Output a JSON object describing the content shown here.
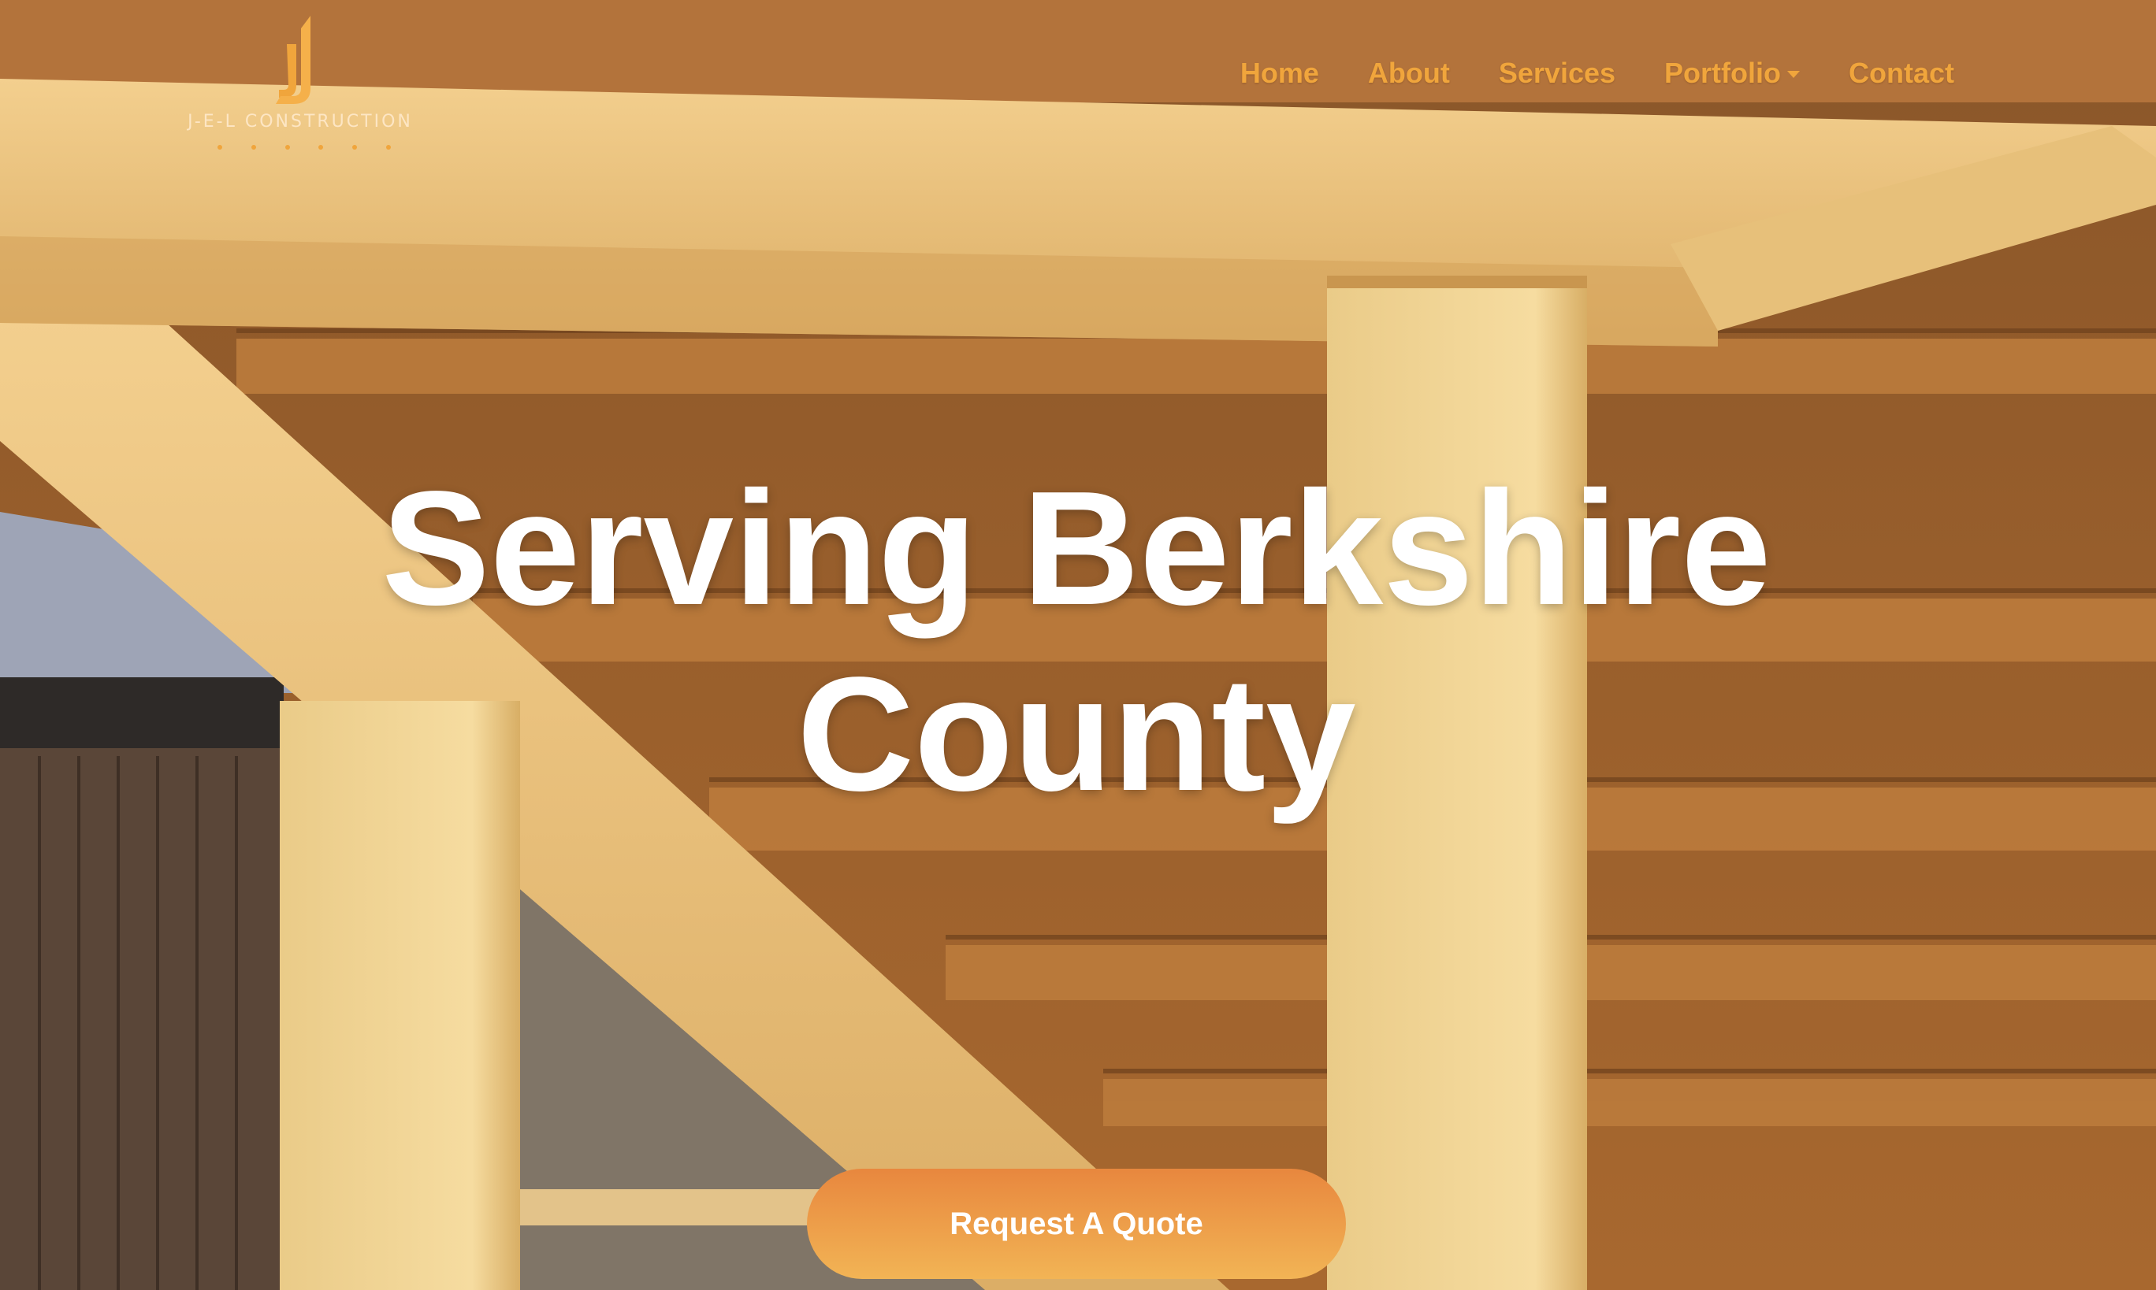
{
  "brand": {
    "logo_text": "J-E-L CONSTRUCTION",
    "accent_color": "#f0a53c"
  },
  "nav": {
    "items": [
      {
        "label": "Home"
      },
      {
        "label": "About"
      },
      {
        "label": "Services"
      },
      {
        "label": "Portfolio",
        "has_dropdown": true
      },
      {
        "label": "Contact"
      }
    ]
  },
  "hero": {
    "headline_line1": "Serving Berkshire",
    "headline_line2": "County",
    "cta_label": "Request A Quote",
    "background": "wooden-pergola-photo"
  }
}
